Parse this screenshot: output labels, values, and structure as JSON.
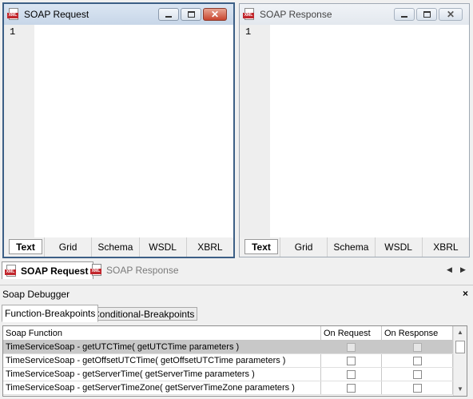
{
  "windows": {
    "request": {
      "title": "SOAP Request",
      "line_number": "1",
      "view_tabs": [
        "Text",
        "Grid",
        "Schema",
        "WSDL",
        "XBRL"
      ],
      "selected_tab": "Text"
    },
    "response": {
      "title": "SOAP Response",
      "line_number": "1",
      "view_tabs": [
        "Text",
        "Grid",
        "Schema",
        "WSDL",
        "XBRL"
      ],
      "selected_tab": "Text"
    }
  },
  "doc_tabs": [
    {
      "label": "SOAP Request",
      "selected": true
    },
    {
      "label": "SOAP Response",
      "selected": false
    }
  ],
  "debugger": {
    "title": "Soap Debugger",
    "close_glyph": "×",
    "tabs": [
      {
        "label": "Function-Breakpoints",
        "selected": true
      },
      {
        "label": "Conditional-Breakpoints",
        "selected": false
      }
    ],
    "columns": [
      "Soap Function",
      "On Request",
      "On Response"
    ],
    "rows": [
      {
        "function": "TimeServiceSoap - getUTCTime( getUTCTime parameters )",
        "on_request": false,
        "on_response": false,
        "selected": true
      },
      {
        "function": "TimeServiceSoap - getOffsetUTCTime( getOffsetUTCTime parameters )",
        "on_request": false,
        "on_response": false,
        "selected": false
      },
      {
        "function": "TimeServiceSoap - getServerTime( getServerTime parameters )",
        "on_request": false,
        "on_response": false,
        "selected": false
      },
      {
        "function": "TimeServiceSoap - getServerTimeZone( getServerTimeZone parameters )",
        "on_request": false,
        "on_response": false,
        "selected": false
      }
    ]
  },
  "icons": {
    "doc_icon": "xml-document-icon",
    "minimize": "minimize-icon",
    "maximize": "maximize-icon",
    "close": "close-icon"
  },
  "colors": {
    "active_title": "#c7d6e8",
    "close_button": "#c8452e",
    "selected_row": "#c8c8c8"
  }
}
